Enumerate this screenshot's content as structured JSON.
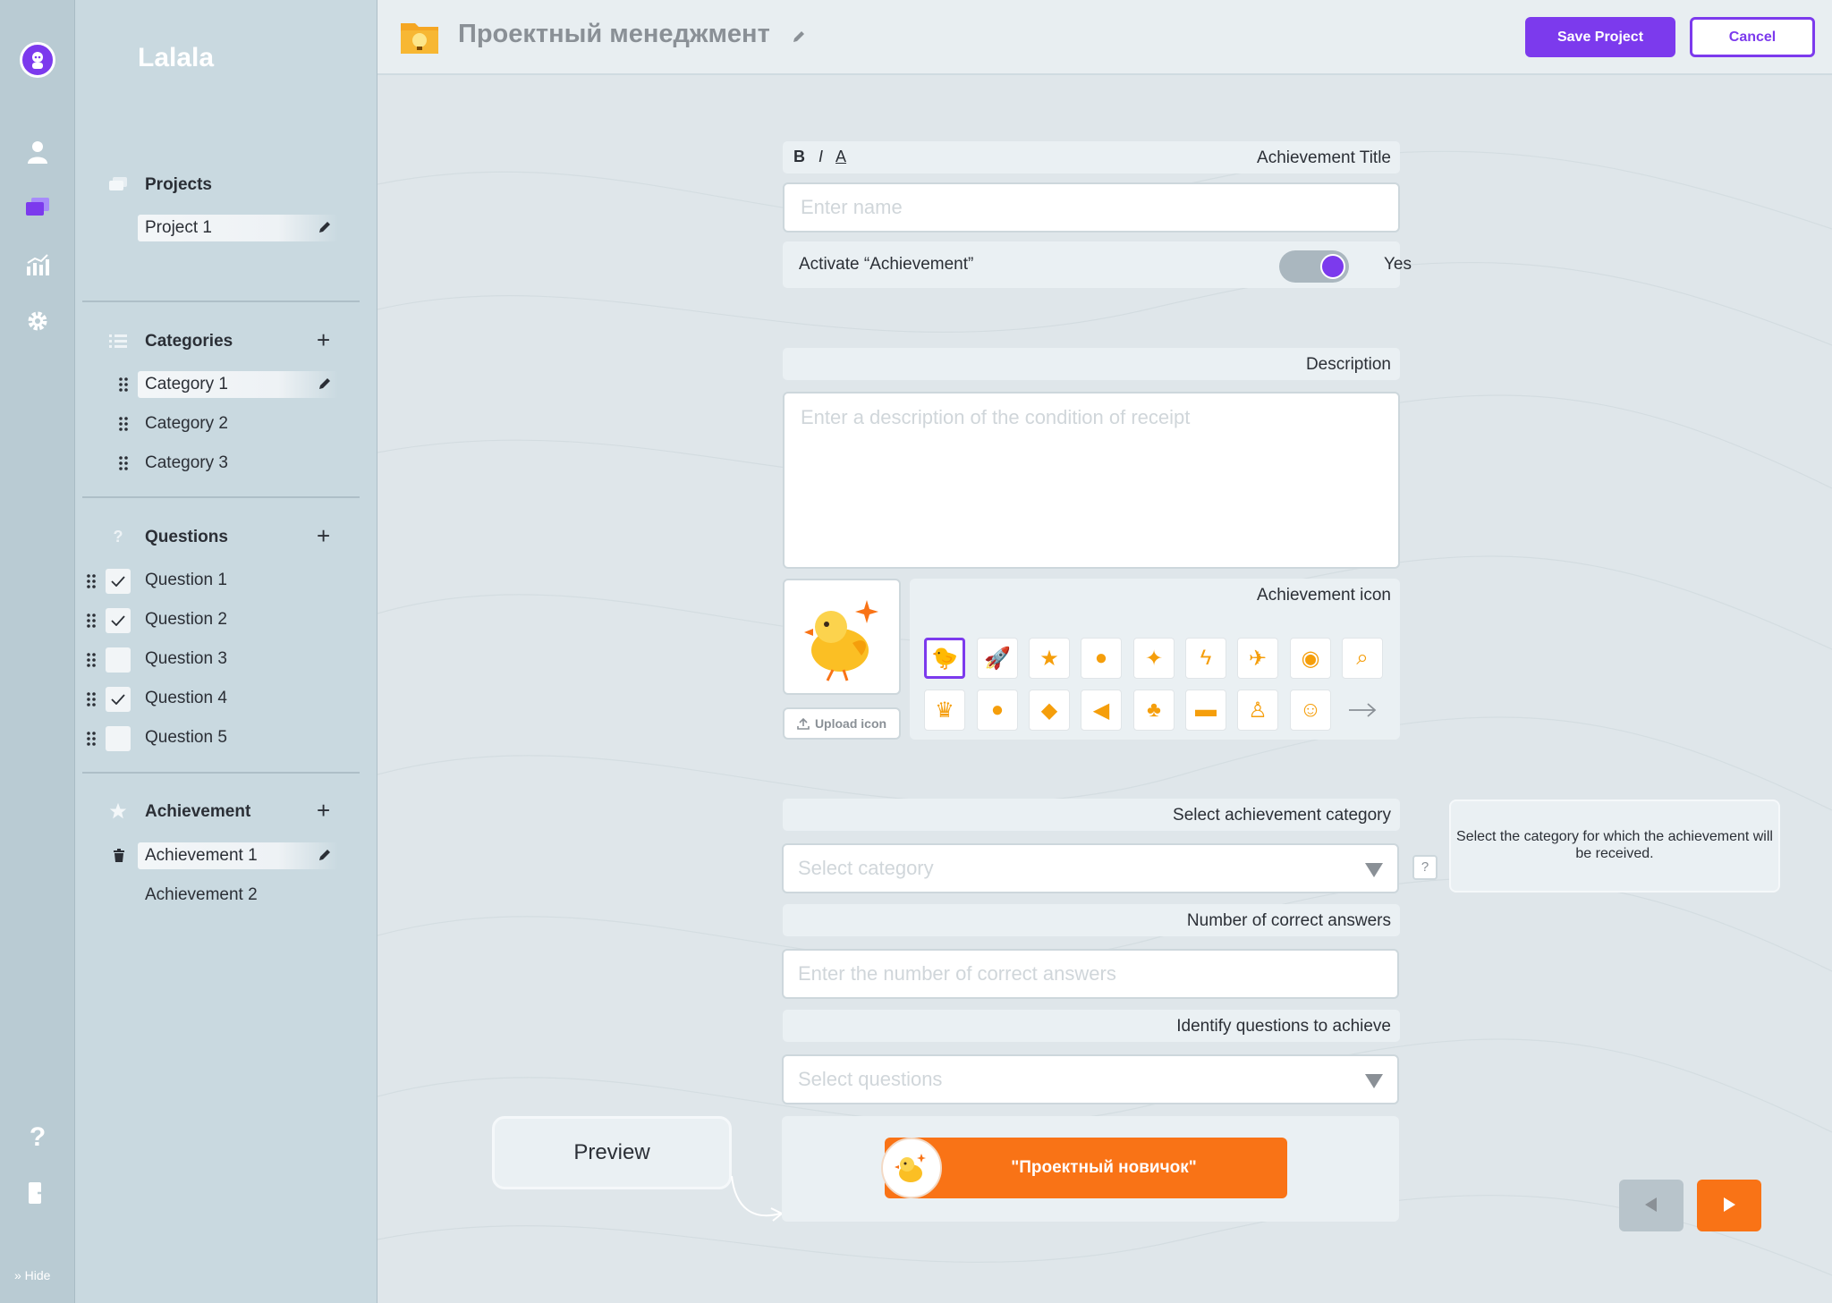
{
  "app": {
    "name": "Lalala",
    "hide_label": "» Hide"
  },
  "project": {
    "title": "Проектный менеджмент"
  },
  "toolbar": {
    "save_label": "Save Project",
    "cancel_label": "Cancel"
  },
  "sidebar": {
    "projects": {
      "title": "Projects",
      "items": [
        "Project 1"
      ]
    },
    "categories": {
      "title": "Categories",
      "items": [
        "Category 1",
        "Category 2",
        "Category 3"
      ]
    },
    "questions": {
      "title": "Questions",
      "items": [
        {
          "label": "Question 1",
          "checked": true
        },
        {
          "label": "Question 2",
          "checked": true
        },
        {
          "label": "Question 3",
          "checked": false
        },
        {
          "label": "Question 4",
          "checked": true
        },
        {
          "label": "Question 5",
          "checked": false
        }
      ]
    },
    "achievements": {
      "title": "Achievement",
      "items": [
        "Achievement 1",
        "Achievement 2"
      ]
    }
  },
  "form": {
    "format": {
      "bold": "B",
      "italic": "I",
      "color": "A"
    },
    "title_label": "Achievement Title",
    "title_placeholder": "Enter name",
    "activate_label": "Activate “Achievement”",
    "activate_value": "Yes",
    "description_label": "Description",
    "description_placeholder": "Enter a description of the condition of receipt",
    "icon_label": "Achievement icon",
    "upload_label": "Upload icon",
    "category_label": "Select achievement category",
    "category_placeholder": "Select category",
    "category_help": "?",
    "category_hint": "Select the category for which the achievement will be received.",
    "correct_label": "Number of correct answers",
    "correct_placeholder": "Enter the number of correct answers",
    "questions_label": "Identify questions to achieve",
    "questions_placeholder": "Select questions",
    "preview_label": "Preview",
    "badge_text": "\"Проектный новичок\""
  },
  "icons": {
    "row1": [
      "chick-icon",
      "rocket-icon",
      "star-icon",
      "bulb-icon",
      "puzzle-icon",
      "lightning-icon",
      "airplane-icon",
      "eye-icon",
      "search-icon"
    ],
    "row2": [
      "crown-icon",
      "apple-icon",
      "diamond-icon",
      "megaphone-icon",
      "palm-icon",
      "chat-icon",
      "trophy-person-icon",
      "team-icon"
    ],
    "selected": "chick-icon"
  },
  "colors": {
    "accent": "#7c3aed",
    "orange": "#f97316"
  }
}
